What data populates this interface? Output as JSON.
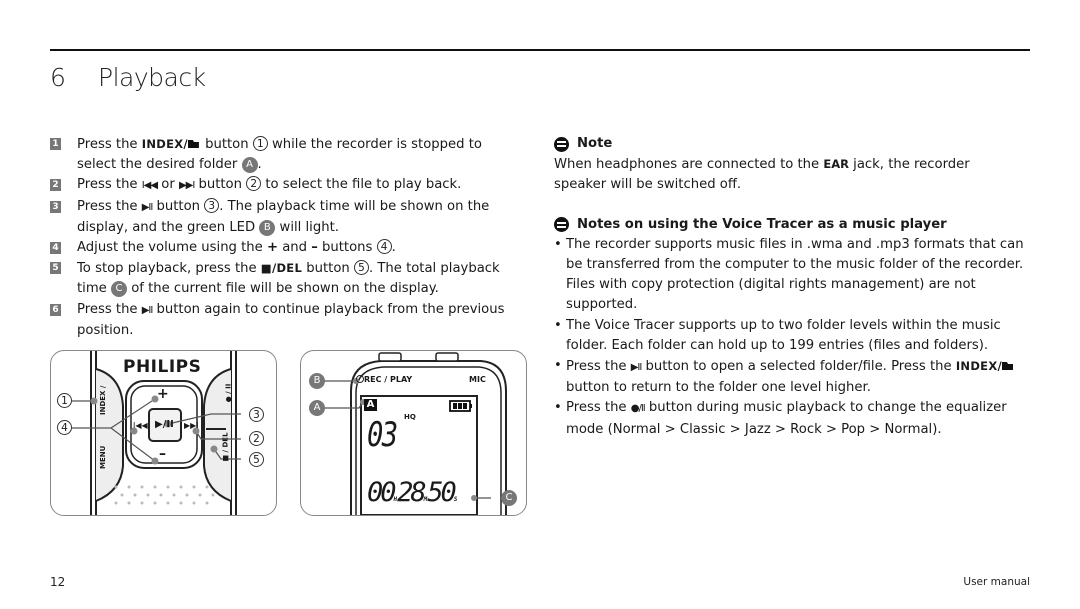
{
  "header": {
    "section_number": "6",
    "section_title": "Playback"
  },
  "steps": [
    {
      "num": "1",
      "parts": [
        "Press the ",
        "INDEX/",
        " button ",
        "1",
        " while the recorder is stopped to select the desired folder ",
        "A",
        "."
      ]
    },
    {
      "num": "2",
      "parts": [
        "Press the ",
        "I◀◀",
        " or ",
        "▶▶I",
        " button ",
        "2",
        " to select the file to play back."
      ]
    },
    {
      "num": "3",
      "parts": [
        "Press the ",
        "▶II",
        " button ",
        "3",
        ". The playback time will be shown on the display, and the green LED ",
        "B",
        " will light."
      ]
    },
    {
      "num": "4",
      "parts": [
        "Adjust the volume using the ",
        "+",
        " and ",
        "–",
        " buttons ",
        "4",
        "."
      ]
    },
    {
      "num": "5",
      "parts": [
        "To stop playback, press the ",
        "■/DEL",
        " button ",
        "5",
        ". The total playback time ",
        "C",
        " of the current file will be shown on the display."
      ]
    },
    {
      "num": "6",
      "parts": [
        "Press the ",
        "▶II",
        " button again to continue playback from the previous position."
      ]
    }
  ],
  "note": {
    "heading": "Note",
    "text_before": "When headphones are connected to the ",
    "text_bold": "EAR",
    "text_after": " jack, the recorder speaker will be switched off."
  },
  "music_notes": {
    "heading": "Notes on using the Voice Tracer as a music player",
    "bullets": [
      "The recorder supports music files in .wma and .mp3 formats that can be transferred from the computer to the music folder of the recorder. Files with copy protection (digital rights management) are not supported.",
      "The Voice Tracer supports up to two folder levels within the music folder. Each folder can hold up to 199 entries (files and folders).",
      {
        "a": "Press the ",
        "sym": "▶II",
        "b": " button to open a selected folder/file. Press the ",
        "kb": "INDEX/",
        "c": " button to return to the folder one level higher."
      },
      {
        "a": "Press the ",
        "sym": "●/II",
        "b": " button during music playback to change the equalizer mode (Normal > Classic > Jazz > Rock > Pop > Normal)."
      }
    ]
  },
  "figure_left": {
    "brand": "PHILIPS",
    "side_left_top": "INDEX / ",
    "side_left_bottom": "MENU",
    "side_right_top": "● / II",
    "side_right_bottom": "■ / DEL",
    "btn_plus": "+",
    "btn_minus": "–",
    "btn_prev": "I◀◀",
    "btn_next": "▶▶I",
    "btn_play": "▶/II",
    "callouts": [
      "1",
      "4",
      "3",
      "2",
      "5"
    ]
  },
  "figure_right": {
    "led_label": "REC / PLAY",
    "mic_label": "MIC",
    "folder": "A",
    "quality": "HQ",
    "file_number": "03",
    "time_h": "00",
    "time_m": "28",
    "time_s": "50",
    "unit_h": "H",
    "unit_m": "M",
    "unit_s": "S",
    "callouts": [
      "B",
      "A",
      "C"
    ]
  },
  "footer": {
    "page_number": "12",
    "doc_name": "User manual"
  }
}
